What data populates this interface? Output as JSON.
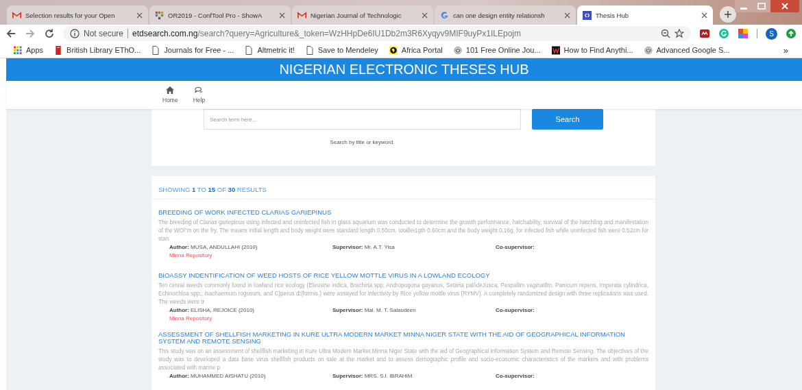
{
  "browser": {
    "tabs": [
      {
        "title": "Selection results for your Open",
        "selected": false
      },
      {
        "title": "OR2019 - ConfTool Pro - ShowA",
        "selected": false
      },
      {
        "title": "Nigerian Journal of Technologic",
        "selected": false
      },
      {
        "title": "can one design entity relationsh",
        "selected": false
      },
      {
        "title": "Thesis Hub",
        "selected": true
      }
    ],
    "security": "Not secure",
    "url_host": "etdsearch.com.ng",
    "url_path": "/search?query=Agriculture&_token=WzHHpDe6IU1Db2m3R6Xyqyv9MIF9uyPx1ILEpojm",
    "profile_initial": "S",
    "bookmarks": [
      {
        "label": "Apps"
      },
      {
        "label": "British Library EThO..."
      },
      {
        "label": "Journals for Free - ..."
      },
      {
        "label": "Altmetric it!"
      },
      {
        "label": "Save to Mendeley"
      },
      {
        "label": "Africa Portal"
      },
      {
        "label": "101 Free Online Jou..."
      },
      {
        "label": "How to Find Anythi..."
      },
      {
        "label": "Advanced Google S..."
      }
    ],
    "bookmarks_more": "»"
  },
  "site": {
    "title": "NIGERIAN ELECTRONIC THESES HUB",
    "nav": [
      {
        "label": "Home"
      },
      {
        "label": "Help"
      }
    ],
    "search": {
      "placeholder": "Search term here...",
      "button": "Search",
      "hint": "Search by title or keyword."
    }
  },
  "results": {
    "summary": "SHOWING **1** TO **15** OF **30** RESULTS",
    "items": [
      {
        "title": "BREEDING OF WORK INFECTED CLARIAS GARIEPINUS",
        "abstract": "The breeding of Clarias gariepinus using infected and uninfected fish in glass aquarium was conducted to determine the growth performance, hatchability, survival of the hatchling and manifestation of the WOl\"m on the fry. The means initial length and body weight were standard length 0.50cm, totallei1gth 0.60cm and the body weight 0.16g, for infected fish while uninfected fish were 0.52cm for stan",
        "author": "**Author:** MUSA, ANDULLAHI (2010)",
        "supervisor": "**Supervisor:** Mr. A.T. Yisa",
        "cosupervisor": "Co-supervisor:",
        "repository": "Minna Repository"
      },
      {
        "title": "BIOASSY INDENTIFICATION OF WEED HOSTS OF RICE YELLOW MOTTLE VIRUS IN A LOWLAND ECOLOGY",
        "abstract": "Ten cereal weeds commonly found in lowland rice ecology (Eleusine indica, Brachiria spp, Andropogona gayanus, Setaria pal/ideJusca, Paspallim vaginatllm. Panicum repens, Imperata cylindrica, Echinochloa spp., Isachaemum rogusum, and C)perus d!(formis.) were assayed for infectivity by Rice yellow mottle virus (RYMV). A completely randomized design with three replications was used. The weeds were tr",
        "author": "**Author:** ELISHA, REJOICE (2010)",
        "supervisor": "**Supervisor:** Mal. M. T. Salaudeen",
        "cosupervisor": "Co-supervisor:",
        "repository": "Minna Repository"
      },
      {
        "title": "ASSESSMENT OF SHELLFISH MARKETING IN KURE ULTRA MODERN MARKET MINNA NIGER STATE WITH THE AID OF GEOGRAPHICAL INFORMATION SYSTEM AND REMOTE SENSING",
        "abstract": "This study was on an assessment of shellfish marketing in Kure Ultra Modern Market Minna Niger State with the aid of Geographical Information System and Remote Sensing. The objectives of the study was to developed a data base virus shellfish products on sale at the market and to assess demographic profile and socio-economic characteristics of the markers and with problems associated with marine p",
        "author": "**Author:** MUHAMMED AISHATU (2010)",
        "supervisor": "**Supervisor:** MRS. S.I. IBRAHIM",
        "cosupervisor": "Co-supervisor:"
      }
    ]
  }
}
